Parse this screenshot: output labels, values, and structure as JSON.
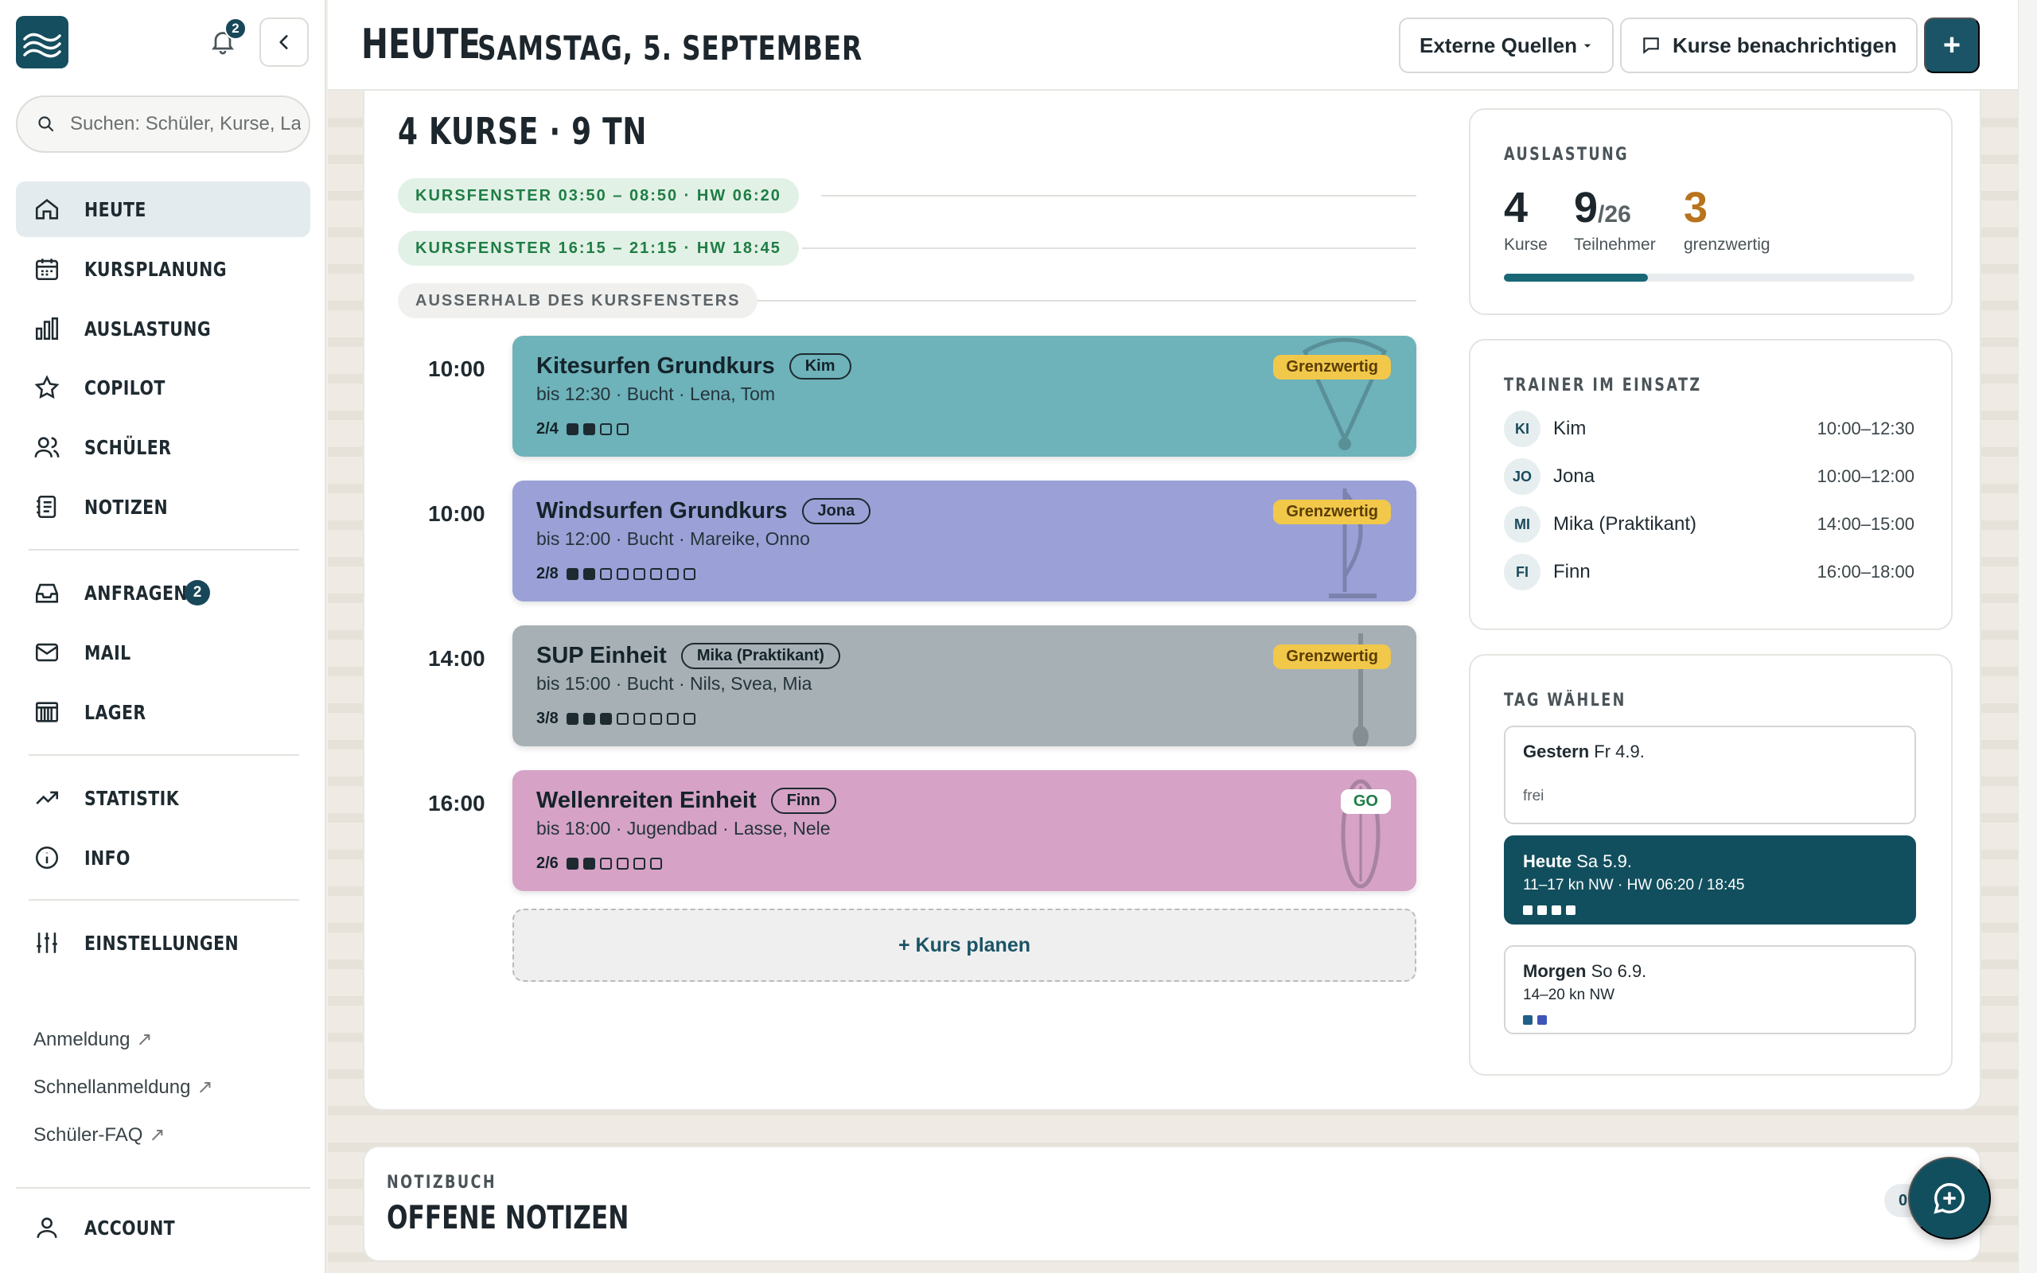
{
  "sidebar": {
    "notifications_count": "2",
    "search_placeholder": "Suchen: Schüler, Kurse, Lager …",
    "nav": [
      {
        "label": "HEUTE",
        "icon": "home-icon"
      },
      {
        "label": "KURSPLANUNG",
        "icon": "calendar-icon"
      },
      {
        "label": "AUSLASTUNG",
        "icon": "bar-chart-icon"
      },
      {
        "label": "COPILOT",
        "icon": "star-icon"
      },
      {
        "label": "SCHÜLER",
        "icon": "users-icon"
      },
      {
        "label": "NOTIZEN",
        "icon": "notes-icon"
      },
      {
        "label": "ANFRAGEN",
        "icon": "inbox-icon",
        "badge": "2"
      },
      {
        "label": "MAIL",
        "icon": "mail-icon"
      },
      {
        "label": "LAGER",
        "icon": "warehouse-icon"
      },
      {
        "label": "STATISTIK",
        "icon": "trend-icon"
      },
      {
        "label": "INFO",
        "icon": "info-icon"
      },
      {
        "label": "EINSTELLUNGEN",
        "icon": "sliders-icon"
      }
    ],
    "links": [
      {
        "label": "Anmeldung",
        "arrow": "↗"
      },
      {
        "label": "Schnellanmeldung",
        "arrow": "↗"
      },
      {
        "label": "Schüler-FAQ",
        "arrow": "↗"
      }
    ],
    "account_label": "ACCOUNT"
  },
  "header": {
    "title": "HEUTE",
    "date": "SAMSTAG, 5. SEPTEMBER",
    "external_sources": "Externe Quellen",
    "notify_courses": "Kurse benachrichtigen",
    "add": "+"
  },
  "main": {
    "summary": "4 KURSE · 9 TN",
    "windows": [
      "KURSFENSTER 03:50 – 08:50 · HW 06:20",
      "KURSFENSTER 16:15 – 21:15 · HW 18:45"
    ],
    "outside_window": "AUSSERHALB DES KURSFENSTERS",
    "courses": [
      {
        "time": "10:00",
        "name": "Kitesurfen Grundkurs",
        "trainer": "Kim",
        "sub": "bis 12:30 · Bucht · Lena, Tom",
        "count": "2/4",
        "filled": 2,
        "total": 4,
        "status": "Grenzwertig",
        "color": "#6eb2ba",
        "art": "kite"
      },
      {
        "time": "10:00",
        "name": "Windsurfen Grundkurs",
        "trainer": "Jona",
        "sub": "bis 12:00 · Bucht · Mareike, Onno",
        "count": "2/8",
        "filled": 2,
        "total": 8,
        "status": "Grenzwertig",
        "color": "#9ba1d6",
        "art": "windsurf"
      },
      {
        "time": "14:00",
        "name": "SUP Einheit",
        "trainer": "Mika (Praktikant)",
        "sub": "bis 15:00 · Bucht · Nils, Svea, Mia",
        "count": "3/8",
        "filled": 3,
        "total": 8,
        "status": "Grenzwertig",
        "color": "#a7b0b5",
        "art": "sup"
      },
      {
        "time": "16:00",
        "name": "Wellenreiten Einheit",
        "trainer": "Finn",
        "sub": "bis 18:00 · Jugendbad · Lasse, Nele",
        "count": "2/6",
        "filled": 2,
        "total": 6,
        "status": "GO",
        "color": "#d6a2c6",
        "art": "surf"
      }
    ],
    "plan_course": "+ Kurs planen"
  },
  "load": {
    "label": "AUSLASTUNG",
    "courses_value": "4",
    "courses_caption": "Kurse",
    "participants_value": "9",
    "participants_total": "/26",
    "participants_caption": "Teilnehmer",
    "critical_value": "3",
    "critical_caption": "grenzwertig",
    "progress_fraction": 0.35
  },
  "trainers": {
    "label": "TRAINER IM EINSATZ",
    "list": [
      {
        "initials": "KI",
        "name": "Kim",
        "time": "10:00–12:30"
      },
      {
        "initials": "JO",
        "name": "Jona",
        "time": "10:00–12:00"
      },
      {
        "initials": "MI",
        "name": "Mika (Praktikant)",
        "time": "14:00–15:00"
      },
      {
        "initials": "FI",
        "name": "Finn",
        "time": "16:00–18:00"
      }
    ]
  },
  "days": {
    "label": "TAG WÄHLEN",
    "list": [
      {
        "name": "Gestern",
        "date": "Fr 4.9.",
        "info": "frei",
        "dots": 0
      },
      {
        "name": "Heute",
        "date": "Sa 5.9.",
        "info": "11–17 kn NW · HW 06:20 / 18:45",
        "dots": 4
      },
      {
        "name": "Morgen",
        "date": "So 6.9.",
        "info": "14–20 kn NW",
        "dots": 2
      }
    ]
  },
  "notebook": {
    "label": "NOTIZBUCH",
    "title": "OFFENE NOTIZEN",
    "count": "0"
  }
}
